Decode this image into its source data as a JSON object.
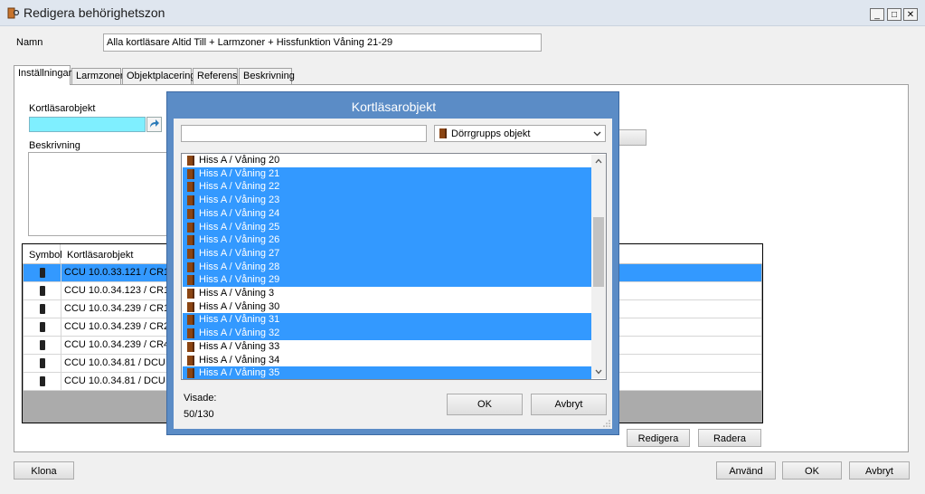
{
  "window": {
    "title": "Redigera behörighetszon"
  },
  "form": {
    "name_label": "Namn",
    "name_value": "Alla kortläsare Altid Till + Larmzoner + Hissfunktion Våning 21-29"
  },
  "tabs": [
    {
      "label": "Inställningar",
      "active": true
    },
    {
      "label": "Larmzoner",
      "active": false
    },
    {
      "label": "Objektplacering",
      "active": false
    },
    {
      "label": "Referens",
      "active": false
    },
    {
      "label": "Beskrivning",
      "active": false
    }
  ],
  "settings": {
    "reader_label": "Kortläsarobjekt",
    "description_label": "Beskrivning"
  },
  "table": {
    "col_symbol": "Symbol",
    "col_reader": "Kortläsarobjekt",
    "rows": [
      {
        "text": "CCU 10.0.33.121 / CR1",
        "selected": true
      },
      {
        "text": "CCU 10.0.34.123 / CR1",
        "selected": false
      },
      {
        "text": "CCU 10.0.34.239 / CR1",
        "selected": false
      },
      {
        "text": "CCU 10.0.34.239 / CR2",
        "selected": false
      },
      {
        "text": "CCU 10.0.34.239 / CR4",
        "selected": false
      },
      {
        "text": "CCU 10.0.34.81 /  DCU 1",
        "selected": false
      },
      {
        "text": "CCU 10.0.34.81 /  DCU 1",
        "selected": false
      }
    ]
  },
  "buttons": {
    "edit": "Redigera",
    "delete": "Radera",
    "clone": "Klona",
    "apply": "Använd",
    "ok": "OK",
    "cancel": "Avbryt"
  },
  "dialog": {
    "title": "Kortläsarobjekt",
    "search_value": "",
    "filter_selected": "Dörrgrupps objekt",
    "shown_label": "Visade:",
    "shown_count": "50/130",
    "ok": "OK",
    "cancel": "Avbryt",
    "items": [
      {
        "label": "Hiss A / Våning 20",
        "selected": false
      },
      {
        "label": "Hiss A / Våning 21",
        "selected": true
      },
      {
        "label": "Hiss A / Våning 22",
        "selected": true
      },
      {
        "label": "Hiss A / Våning 23",
        "selected": true
      },
      {
        "label": "Hiss A / Våning 24",
        "selected": true
      },
      {
        "label": "Hiss A / Våning 25",
        "selected": true
      },
      {
        "label": "Hiss A / Våning 26",
        "selected": true
      },
      {
        "label": "Hiss A / Våning 27",
        "selected": true
      },
      {
        "label": "Hiss A / Våning 28",
        "selected": true
      },
      {
        "label": "Hiss A / Våning 29",
        "selected": true
      },
      {
        "label": "Hiss A / Våning 3",
        "selected": false
      },
      {
        "label": "Hiss A / Våning 30",
        "selected": false
      },
      {
        "label": "Hiss A / Våning 31",
        "selected": true
      },
      {
        "label": "Hiss A / Våning 32",
        "selected": true
      },
      {
        "label": "Hiss A / Våning 33",
        "selected": false
      },
      {
        "label": "Hiss A / Våning 34",
        "selected": false
      },
      {
        "label": "Hiss A / Våning 35",
        "selected": true
      }
    ]
  },
  "colors": {
    "selection": "#3399ff",
    "dialog_frame": "#5b8cc6",
    "reader_input": "#7fefff"
  },
  "icons": {
    "app": "door-key-icon",
    "link": "link-arrow-icon",
    "reader": "card-reader-icon",
    "door": "door-icon"
  }
}
